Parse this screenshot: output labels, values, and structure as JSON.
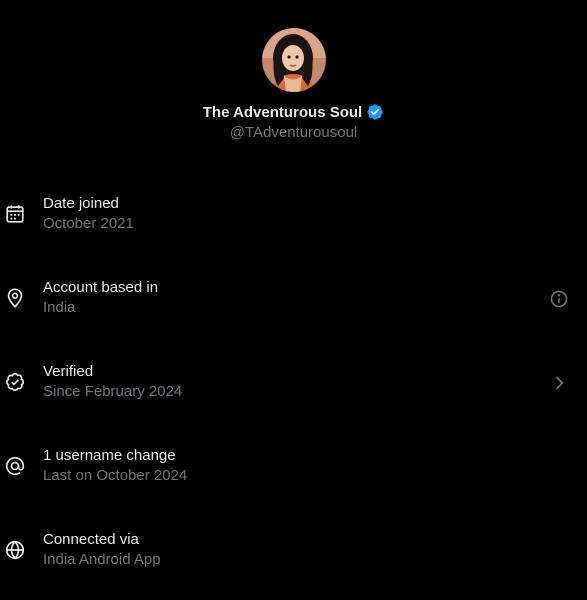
{
  "profile": {
    "display_name": "The Adventurous Soul",
    "handle": "@TAdventurousoul",
    "verified": true
  },
  "rows": [
    {
      "title": "Date joined",
      "subtitle": "October 2021",
      "icon": "calendar-icon",
      "trailing": ""
    },
    {
      "title": "Account based in",
      "subtitle": "India",
      "icon": "location-pin-icon",
      "trailing": "info-icon"
    },
    {
      "title": "Verified",
      "subtitle": "Since February 2024",
      "icon": "verified-check-icon",
      "trailing": "chevron-right-icon"
    },
    {
      "title": "1 username change",
      "subtitle": "Last on October 2024",
      "icon": "at-sign-icon",
      "trailing": ""
    },
    {
      "title": "Connected via",
      "subtitle": "India Android App",
      "icon": "globe-icon",
      "trailing": ""
    }
  ],
  "colors": {
    "background": "#000000",
    "primary_text": "#e7e9ea",
    "secondary_text": "#71767b",
    "verified_blue": "#1d9bf0"
  }
}
